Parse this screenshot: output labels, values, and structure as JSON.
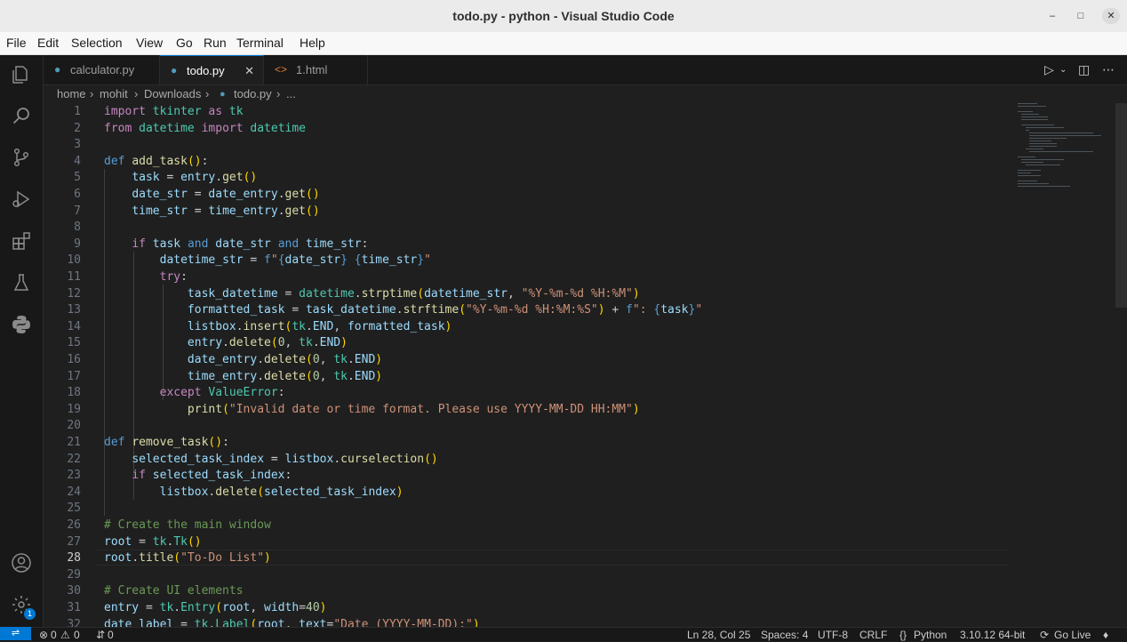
{
  "window": {
    "title": "todo.py - python - Visual Studio Code"
  },
  "menu": [
    "File",
    "Edit",
    "Selection",
    "View",
    "Go",
    "Run",
    "Terminal",
    "Help"
  ],
  "tabs": [
    {
      "label": "calculator.py",
      "icon": "python-file-icon",
      "active": false
    },
    {
      "label": "todo.py",
      "icon": "python-file-icon",
      "active": true
    },
    {
      "label": "1.html",
      "icon": "html-file-icon",
      "active": false
    }
  ],
  "breadcrumb": [
    "home",
    "mohit",
    "Downloads",
    "todo.py",
    "..."
  ],
  "editor": {
    "current_line": 28,
    "lines": [
      [
        [
          "k",
          "import"
        ],
        [
          "p",
          " "
        ],
        [
          "cl",
          "tkinter"
        ],
        [
          "p",
          " "
        ],
        [
          "k",
          "as"
        ],
        [
          "p",
          " "
        ],
        [
          "cl",
          "tk"
        ]
      ],
      [
        [
          "k",
          "from"
        ],
        [
          "p",
          " "
        ],
        [
          "cl",
          "datetime"
        ],
        [
          "p",
          " "
        ],
        [
          "k",
          "import"
        ],
        [
          "p",
          " "
        ],
        [
          "cl",
          "datetime"
        ]
      ],
      [],
      [
        [
          "kb",
          "def"
        ],
        [
          "p",
          " "
        ],
        [
          "f",
          "add_task"
        ],
        [
          "br1",
          "()"
        ],
        [
          "p",
          ":"
        ]
      ],
      [
        [
          "p",
          "    "
        ],
        [
          "v",
          "task"
        ],
        [
          "p",
          " = "
        ],
        [
          "v",
          "entry"
        ],
        [
          "p",
          "."
        ],
        [
          "f",
          "get"
        ],
        [
          "br1",
          "()"
        ]
      ],
      [
        [
          "p",
          "    "
        ],
        [
          "v",
          "date_str"
        ],
        [
          "p",
          " = "
        ],
        [
          "v",
          "date_entry"
        ],
        [
          "p",
          "."
        ],
        [
          "f",
          "get"
        ],
        [
          "br1",
          "()"
        ]
      ],
      [
        [
          "p",
          "    "
        ],
        [
          "v",
          "time_str"
        ],
        [
          "p",
          " = "
        ],
        [
          "v",
          "time_entry"
        ],
        [
          "p",
          "."
        ],
        [
          "f",
          "get"
        ],
        [
          "br1",
          "()"
        ]
      ],
      [],
      [
        [
          "p",
          "    "
        ],
        [
          "k",
          "if"
        ],
        [
          "p",
          " "
        ],
        [
          "v",
          "task"
        ],
        [
          "p",
          " "
        ],
        [
          "kb",
          "and"
        ],
        [
          "p",
          " "
        ],
        [
          "v",
          "date_str"
        ],
        [
          "p",
          " "
        ],
        [
          "kb",
          "and"
        ],
        [
          "p",
          " "
        ],
        [
          "v",
          "time_str"
        ],
        [
          "p",
          ":"
        ]
      ],
      [
        [
          "p",
          "        "
        ],
        [
          "v",
          "datetime_str"
        ],
        [
          "p",
          " = "
        ],
        [
          "kb",
          "f"
        ],
        [
          "s",
          "\""
        ],
        [
          "kb",
          "{"
        ],
        [
          "v",
          "date_str"
        ],
        [
          "kb",
          "}"
        ],
        [
          "s",
          " "
        ],
        [
          "kb",
          "{"
        ],
        [
          "v",
          "time_str"
        ],
        [
          "kb",
          "}"
        ],
        [
          "s",
          "\""
        ]
      ],
      [
        [
          "p",
          "        "
        ],
        [
          "k",
          "try"
        ],
        [
          "p",
          ":"
        ]
      ],
      [
        [
          "p",
          "            "
        ],
        [
          "v",
          "task_datetime"
        ],
        [
          "p",
          " = "
        ],
        [
          "cl",
          "datetime"
        ],
        [
          "p",
          "."
        ],
        [
          "f",
          "strptime"
        ],
        [
          "br1",
          "("
        ],
        [
          "v",
          "datetime_str"
        ],
        [
          "p",
          ", "
        ],
        [
          "s",
          "\"%Y-%m-%d %H:%M\""
        ],
        [
          "br1",
          ")"
        ]
      ],
      [
        [
          "p",
          "            "
        ],
        [
          "v",
          "formatted_task"
        ],
        [
          "p",
          " = "
        ],
        [
          "v",
          "task_datetime"
        ],
        [
          "p",
          "."
        ],
        [
          "f",
          "strftime"
        ],
        [
          "br1",
          "("
        ],
        [
          "s",
          "\"%Y-%m-%d %H:%M:%S\""
        ],
        [
          "br1",
          ")"
        ],
        [
          "p",
          " + "
        ],
        [
          "kb",
          "f"
        ],
        [
          "s",
          "\": "
        ],
        [
          "kb",
          "{"
        ],
        [
          "v",
          "task"
        ],
        [
          "kb",
          "}"
        ],
        [
          "s",
          "\""
        ]
      ],
      [
        [
          "p",
          "            "
        ],
        [
          "v",
          "listbox"
        ],
        [
          "p",
          "."
        ],
        [
          "f",
          "insert"
        ],
        [
          "br1",
          "("
        ],
        [
          "cl",
          "tk"
        ],
        [
          "p",
          "."
        ],
        [
          "v",
          "END"
        ],
        [
          "p",
          ", "
        ],
        [
          "v",
          "formatted_task"
        ],
        [
          "br1",
          ")"
        ]
      ],
      [
        [
          "p",
          "            "
        ],
        [
          "v",
          "entry"
        ],
        [
          "p",
          "."
        ],
        [
          "f",
          "delete"
        ],
        [
          "br1",
          "("
        ],
        [
          "n",
          "0"
        ],
        [
          "p",
          ", "
        ],
        [
          "cl",
          "tk"
        ],
        [
          "p",
          "."
        ],
        [
          "v",
          "END"
        ],
        [
          "br1",
          ")"
        ]
      ],
      [
        [
          "p",
          "            "
        ],
        [
          "v",
          "date_entry"
        ],
        [
          "p",
          "."
        ],
        [
          "f",
          "delete"
        ],
        [
          "br1",
          "("
        ],
        [
          "n",
          "0"
        ],
        [
          "p",
          ", "
        ],
        [
          "cl",
          "tk"
        ],
        [
          "p",
          "."
        ],
        [
          "v",
          "END"
        ],
        [
          "br1",
          ")"
        ]
      ],
      [
        [
          "p",
          "            "
        ],
        [
          "v",
          "time_entry"
        ],
        [
          "p",
          "."
        ],
        [
          "f",
          "delete"
        ],
        [
          "br1",
          "("
        ],
        [
          "n",
          "0"
        ],
        [
          "p",
          ", "
        ],
        [
          "cl",
          "tk"
        ],
        [
          "p",
          "."
        ],
        [
          "v",
          "END"
        ],
        [
          "br1",
          ")"
        ]
      ],
      [
        [
          "p",
          "        "
        ],
        [
          "k",
          "except"
        ],
        [
          "p",
          " "
        ],
        [
          "cl",
          "ValueError"
        ],
        [
          "p",
          ":"
        ]
      ],
      [
        [
          "p",
          "            "
        ],
        [
          "f",
          "print"
        ],
        [
          "br1",
          "("
        ],
        [
          "s",
          "\"Invalid date or time format. Please use YYYY-MM-DD HH:MM\""
        ],
        [
          "br1",
          ")"
        ]
      ],
      [],
      [
        [
          "kb",
          "def"
        ],
        [
          "p",
          " "
        ],
        [
          "f",
          "remove_task"
        ],
        [
          "br1",
          "()"
        ],
        [
          "p",
          ":"
        ]
      ],
      [
        [
          "p",
          "    "
        ],
        [
          "v",
          "selected_task_index"
        ],
        [
          "p",
          " = "
        ],
        [
          "v",
          "listbox"
        ],
        [
          "p",
          "."
        ],
        [
          "f",
          "curselection"
        ],
        [
          "br1",
          "()"
        ]
      ],
      [
        [
          "p",
          "    "
        ],
        [
          "k",
          "if"
        ],
        [
          "p",
          " "
        ],
        [
          "v",
          "selected_task_index"
        ],
        [
          "p",
          ":"
        ]
      ],
      [
        [
          "p",
          "        "
        ],
        [
          "v",
          "listbox"
        ],
        [
          "p",
          "."
        ],
        [
          "f",
          "delete"
        ],
        [
          "br1",
          "("
        ],
        [
          "v",
          "selected_task_index"
        ],
        [
          "br1",
          ")"
        ]
      ],
      [],
      [
        [
          "c",
          "# Create the main window"
        ]
      ],
      [
        [
          "v",
          "root"
        ],
        [
          "p",
          " = "
        ],
        [
          "cl",
          "tk"
        ],
        [
          "p",
          "."
        ],
        [
          "cl",
          "Tk"
        ],
        [
          "br1",
          "()"
        ]
      ],
      [
        [
          "v",
          "root"
        ],
        [
          "p",
          "."
        ],
        [
          "f",
          "title"
        ],
        [
          "br1",
          "("
        ],
        [
          "s",
          "\"To-Do List\""
        ],
        [
          "br1",
          ")"
        ]
      ],
      [],
      [
        [
          "c",
          "# Create UI elements"
        ]
      ],
      [
        [
          "v",
          "entry"
        ],
        [
          "p",
          " = "
        ],
        [
          "cl",
          "tk"
        ],
        [
          "p",
          "."
        ],
        [
          "cl",
          "Entry"
        ],
        [
          "br1",
          "("
        ],
        [
          "v",
          "root"
        ],
        [
          "p",
          ", "
        ],
        [
          "v",
          "width"
        ],
        [
          "p",
          "="
        ],
        [
          "n",
          "40"
        ],
        [
          "br1",
          ")"
        ]
      ],
      [
        [
          "v",
          "date_label"
        ],
        [
          "p",
          " = "
        ],
        [
          "cl",
          "tk"
        ],
        [
          "p",
          "."
        ],
        [
          "cl",
          "Label"
        ],
        [
          "br1",
          "("
        ],
        [
          "v",
          "root"
        ],
        [
          "p",
          ", "
        ],
        [
          "v",
          "text"
        ],
        [
          "p",
          "="
        ],
        [
          "s",
          "\"Date (YYYY-MM-DD):\""
        ],
        [
          "br1",
          ")"
        ]
      ]
    ]
  },
  "status": {
    "errors": "0",
    "warnings": "0",
    "ports": "0",
    "position": "Ln 28, Col 25",
    "spaces": "Spaces: 4",
    "encoding": "UTF-8",
    "eol": "CRLF",
    "language": "Python",
    "interpreter": "3.10.12 64-bit",
    "golive": "Go Live"
  },
  "accounts_badge": "1",
  "colors": {
    "accent": "#0078d4",
    "editor_bg": "#1f1f1f",
    "titlebar_bg": "#ebebeb"
  }
}
